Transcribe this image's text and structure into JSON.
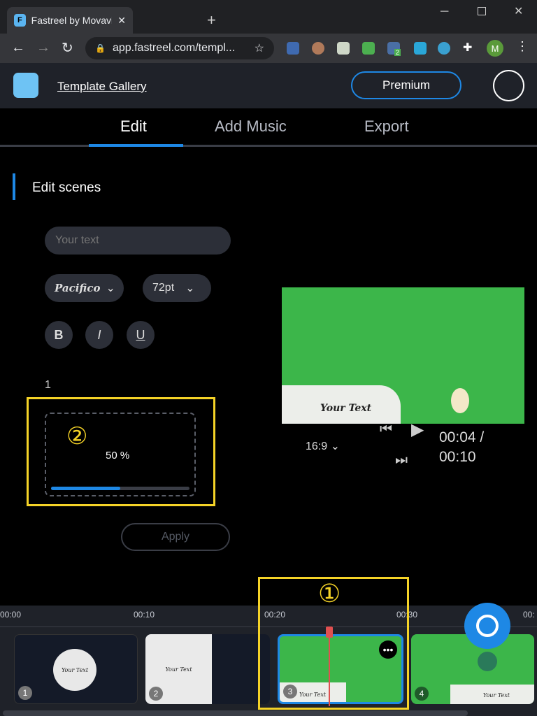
{
  "browser": {
    "tab_title": "Fastreel by Movavi | Online Vid",
    "url": "app.fastreel.com/templ...",
    "profile_initial": "M",
    "ext_badge": "2"
  },
  "header": {
    "gallery_link": "Template Gallery",
    "premium_label": "Premium"
  },
  "tabs": [
    {
      "label": "Edit",
      "active": true
    },
    {
      "label": "Add Music"
    },
    {
      "label": "Export"
    }
  ],
  "editor": {
    "section_title": "Edit scenes",
    "text_placeholder": "Your text",
    "font": "Pacifico",
    "size": "72pt",
    "bold": "B",
    "italic": "I",
    "underline": "U",
    "scene_number": "1",
    "upload_progress_text": "50 %",
    "upload_progress": 0.5,
    "apply_label": "Apply",
    "annotation_2": "②"
  },
  "preview": {
    "caption": "Your Text",
    "aspect": "16:9",
    "time_current": "00:04 /",
    "time_total": "00:10"
  },
  "timeline": {
    "ticks": [
      "00:00",
      "00:10",
      "00:20",
      "00:30",
      "00:"
    ],
    "annotation_1": "①",
    "clips": [
      {
        "n": "1",
        "text": "Your Text"
      },
      {
        "n": "2",
        "text": "Your Text"
      },
      {
        "n": "3",
        "text": "Your Text"
      },
      {
        "n": "4",
        "text": "Your Text"
      }
    ]
  },
  "colors": {
    "accent": "#1e88e5",
    "green": "#3cb64a",
    "annotation": "#f5d327"
  }
}
